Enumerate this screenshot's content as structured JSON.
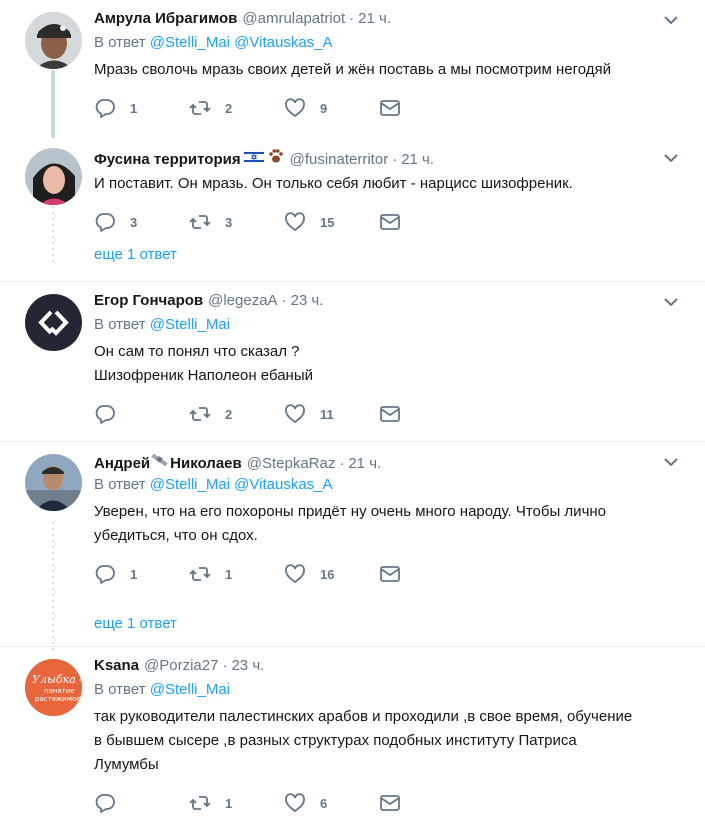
{
  "tweets": [
    {
      "name": "Амрула Ибрагимов",
      "handle": "@amrulapatriot",
      "time": "21 ч.",
      "reply_prefix": "В ответ",
      "reply_to": "@Stelli_Mai @Vitauskas_A",
      "text": [
        "Мразь сволочь мразь своих детей и жён поставь а мы посмотрим негодяй"
      ],
      "replies": "1",
      "retweets": "2",
      "likes": "9"
    },
    {
      "name": "Фусина территория",
      "handle": "@fusinaterritor",
      "time": "21 ч.",
      "text": [
        "И поставит. Он мразь. Он только себя любит - нарцисс шизофреник."
      ],
      "replies": "3",
      "retweets": "3",
      "likes": "15",
      "more": "еще 1 ответ"
    },
    {
      "name": "Егор Гончаров",
      "handle": "@legezaA",
      "time": "23 ч.",
      "reply_prefix": "В ответ",
      "reply_to": "@Stelli_Mai",
      "text": [
        "Он сам то понял что сказал ?",
        "Шизофреник Наполеон ебаный"
      ],
      "replies": "",
      "retweets": "2",
      "likes": "11"
    },
    {
      "name": "Андрей",
      "name_suffix": "Николаев",
      "handle": "@StepkaRaz",
      "time": "21 ч.",
      "reply_prefix": "В ответ",
      "reply_to": "@Stelli_Mai @Vitauskas_A",
      "text": [
        "Уверен, что на его похороны придёт ну очень много народу. Чтобы лично",
        "убедиться, что он сдох."
      ],
      "replies": "1",
      "retweets": "1",
      "likes": "16",
      "more": "еще 1 ответ"
    },
    {
      "name": "Ksana",
      "handle": "@Porzia27",
      "time": "23 ч.",
      "reply_prefix": "В ответ",
      "reply_to": "@Stelli_Mai",
      "text": [
        "так руководители палестинских арабов и проходили ,в свое время, обучение",
        "в бывшем сысере ,в разных структурах подобных институту Патриса",
        "Лумумбы"
      ],
      "replies": "",
      "retweets": "1",
      "likes": "6",
      "avatar_text": [
        "Улыбка -",
        "понятие",
        "растяжимое"
      ]
    }
  ],
  "colors": {
    "link": "#1da1f2",
    "muted": "#657786",
    "border": "#e6ecf0",
    "thread": "#ccd6dd"
  },
  "icons": [
    "reply-icon",
    "retweet-icon",
    "like-icon",
    "dm-icon",
    "caret-down-icon",
    "israel-flag-icon",
    "paw-icon",
    "satellite-icon"
  ]
}
